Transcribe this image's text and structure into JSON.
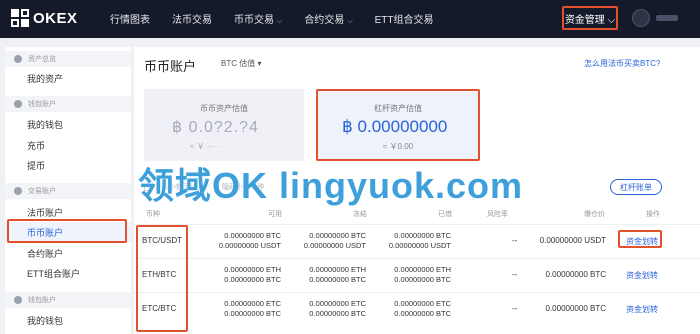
{
  "header": {
    "logo_text": "OKEX",
    "nav": [
      {
        "label": "行情图表",
        "caret": ""
      },
      {
        "label": "法币交易",
        "caret": ""
      },
      {
        "label": "币币交易",
        "caret": "⌵"
      },
      {
        "label": "合约交易",
        "caret": "⌵"
      },
      {
        "label": "ETT组合交易",
        "caret": ""
      }
    ],
    "fund_menu": "资金管理 ⌵"
  },
  "sidebar": {
    "sections": [
      {
        "label": "资产总览"
      },
      {
        "label": "钱包账户"
      },
      {
        "label": "交易账户"
      },
      {
        "label": "钱包账户"
      }
    ],
    "items": [
      {
        "label": "我的资产"
      },
      {
        "label": "我的钱包"
      },
      {
        "label": "充币"
      },
      {
        "label": "提币"
      },
      {
        "label": "法币账户"
      },
      {
        "label": "币币账户"
      },
      {
        "label": "合约账户"
      },
      {
        "label": "ETT组合账户"
      },
      {
        "label": "我的钱包"
      }
    ]
  },
  "main": {
    "title": "币币账户",
    "valuation_select": "BTC 估值 ▾",
    "how_link": "怎么用法币买卖BTC?",
    "spot_card": {
      "label": "币币资产估值",
      "value": "฿ 0.0?2.?4",
      "sub": "≈ ￥ ··· ·"
    },
    "margin_card": {
      "label": "杠杆资产估值",
      "value": "฿ 0.00000000",
      "sub": "≈ ￥0.00"
    },
    "hide_zero": "隐藏小额币种",
    "bills_note": "隐藏小额币种",
    "lever_button": "杠杆账单",
    "table": {
      "headers": [
        "币种",
        "可用",
        "冻结",
        "已借",
        "风险率",
        "爆仓价",
        "操作"
      ],
      "rows": [
        {
          "pair": "BTC/USDT",
          "available": [
            "0.00000000 BTC",
            "0.00000000 USDT"
          ],
          "frozen": [
            "0.00000000 BTC",
            "0.00000000 USDT"
          ],
          "borrowed": [
            "0.00000000 BTC",
            "0.00000000 USDT"
          ],
          "risk": "--",
          "liq_price": "0.00000000 USDT",
          "action": "资金划转"
        },
        {
          "pair": "ETH/BTC",
          "available": [
            "0.00000000 ETH",
            "0.00000000 BTC"
          ],
          "frozen": [
            "0.00000000 ETH",
            "0.00000000 BTC"
          ],
          "borrowed": [
            "0.00000000 ETH",
            "0.00000000 BTC"
          ],
          "risk": "--",
          "liq_price": "0.00000000 BTC",
          "action": "资金划转"
        },
        {
          "pair": "ETC/BTC",
          "available": [
            "0.00000000 ETC",
            "0.00000000 BTC"
          ],
          "frozen": [
            "0.00000000 ETC",
            "0.00000000 BTC"
          ],
          "borrowed": [
            "0.00000000 ETC",
            "0.00000000 BTC"
          ],
          "risk": "--",
          "liq_price": "0.00000000 BTC",
          "action": "资金划转"
        }
      ]
    }
  },
  "watermark": "领域OK lingyuok.com",
  "colors": {
    "accent": "#2a62d9",
    "highlight_box": "#e2502c",
    "topbar": "#141a2a"
  }
}
